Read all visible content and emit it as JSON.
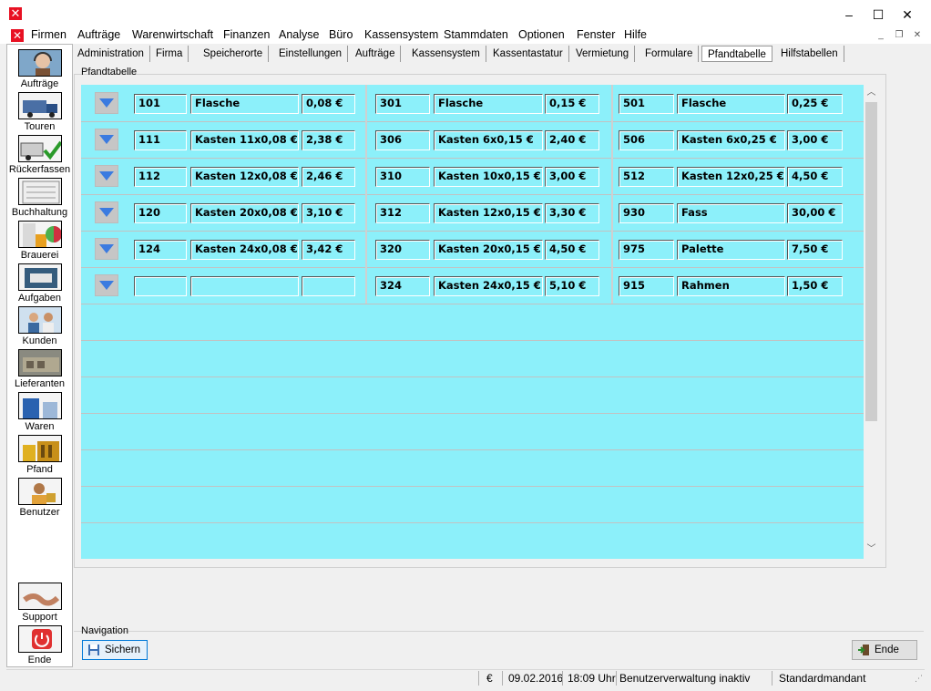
{
  "window": {
    "minimize": "–",
    "maximize": "☐",
    "close": "✕"
  },
  "menu": [
    "Firmen",
    "Aufträge",
    "Warenwirtschaft",
    "Finanzen",
    "Analyse",
    "Büro",
    "Kassensystem",
    "Stammdaten",
    "Optionen",
    "Fenster",
    "Hilfe"
  ],
  "mdi": {
    "minimize": "_",
    "restore": "❐",
    "close": "✕"
  },
  "sidebar": {
    "items": [
      {
        "label": "Aufträge",
        "icon": "headset-operator-icon"
      },
      {
        "label": "Touren",
        "icon": "truck-icon"
      },
      {
        "label": "Rückerfassen",
        "icon": "truck-check-icon"
      },
      {
        "label": "Buchhaltung",
        "icon": "ledger-icon"
      },
      {
        "label": "Brauerei",
        "icon": "brewery-icon"
      },
      {
        "label": "Aufgaben",
        "icon": "tasks-icon"
      },
      {
        "label": "Kunden",
        "icon": "customers-icon"
      },
      {
        "label": "Lieferanten",
        "icon": "suppliers-icon"
      },
      {
        "label": "Waren",
        "icon": "goods-icon"
      },
      {
        "label": "Pfand",
        "icon": "deposit-crates-icon"
      },
      {
        "label": "Benutzer",
        "icon": "user-lock-icon"
      }
    ],
    "support": {
      "label": "Support",
      "icon": "handshake-icon"
    },
    "exit": {
      "label": "Ende",
      "icon": "power-icon"
    }
  },
  "tabs": [
    "Administration",
    "Firma",
    "Speicherorte",
    "Einstellungen",
    "Aufträge",
    "Kassensystem",
    "Kassentastatur",
    "Vermietung",
    "Formulare",
    "Pfandtabelle",
    "Hilfstabellen"
  ],
  "active_tab": "Pfandtabelle",
  "group_title": "Pfandtabelle",
  "table": {
    "rows": [
      {
        "cols": [
          {
            "code": "101",
            "name": "Flasche",
            "price": "0,08 €"
          },
          {
            "code": "301",
            "name": "Flasche",
            "price": "0,15 €"
          },
          {
            "code": "501",
            "name": "Flasche",
            "price": "0,25 €"
          }
        ]
      },
      {
        "cols": [
          {
            "code": "111",
            "name": "Kasten 11x0,08 €",
            "price": "2,38 €"
          },
          {
            "code": "306",
            "name": "Kasten 6x0,15 €",
            "price": "2,40 €"
          },
          {
            "code": "506",
            "name": "Kasten 6x0,25 €",
            "price": "3,00 €"
          }
        ]
      },
      {
        "cols": [
          {
            "code": "112",
            "name": "Kasten 12x0,08 €",
            "price": "2,46 €"
          },
          {
            "code": "310",
            "name": "Kasten 10x0,15 €",
            "price": "3,00 €"
          },
          {
            "code": "512",
            "name": "Kasten 12x0,25 €",
            "price": "4,50 €"
          }
        ]
      },
      {
        "cols": [
          {
            "code": "120",
            "name": "Kasten 20x0,08 €",
            "price": "3,10 €"
          },
          {
            "code": "312",
            "name": "Kasten 12x0,15 €",
            "price": "3,30 €"
          },
          {
            "code": "930",
            "name": "Fass",
            "price": "30,00 €"
          }
        ]
      },
      {
        "cols": [
          {
            "code": "124",
            "name": "Kasten 24x0,08 €",
            "price": "3,42 €"
          },
          {
            "code": "320",
            "name": "Kasten 20x0,15 €",
            "price": "4,50 €"
          },
          {
            "code": "975",
            "name": "Palette",
            "price": "7,50 €"
          }
        ]
      },
      {
        "cols": [
          {
            "code": "",
            "name": "",
            "price": ""
          },
          {
            "code": "324",
            "name": "Kasten 24x0,15 €",
            "price": "5,10 €"
          },
          {
            "code": "915",
            "name": "Rahmen",
            "price": "1,50 €"
          }
        ]
      }
    ]
  },
  "navigation": {
    "label": "Navigation",
    "save": "Sichern",
    "exit": "Ende"
  },
  "status": {
    "currency": "€",
    "date": "09.02.2016",
    "time": "18:09 Uhr",
    "user_admin": "Benutzerverwaltung inaktiv",
    "mandant": "Standardmandant"
  },
  "colors": {
    "grid_bg": "#8cf0fa",
    "accent_red": "#e81123"
  }
}
